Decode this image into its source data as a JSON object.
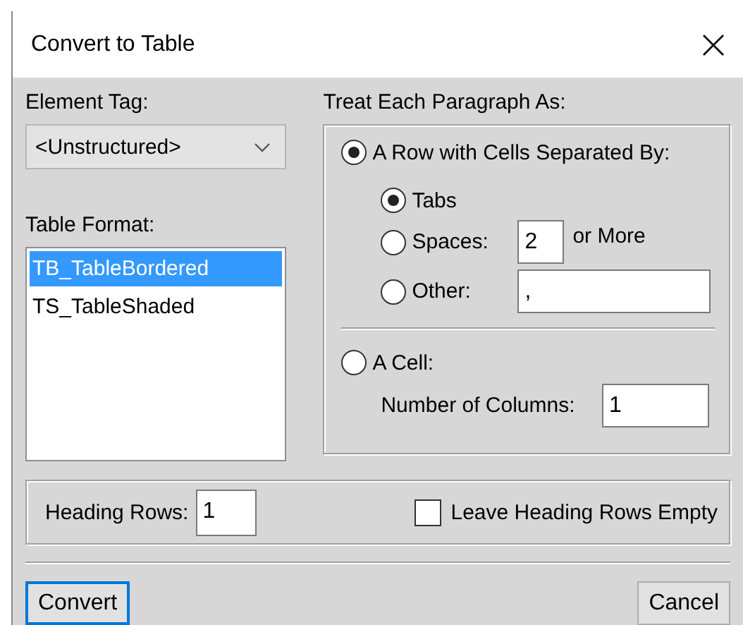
{
  "window": {
    "title": "Convert to Table"
  },
  "element_tag": {
    "label": "Element Tag:",
    "value": "<Unstructured>"
  },
  "table_format": {
    "label": "Table Format:",
    "items": [
      {
        "label": "TB_TableBordered",
        "selected": true
      },
      {
        "label": "TS_TableShaded",
        "selected": false
      }
    ]
  },
  "treat_as": {
    "label": "Treat Each Paragraph As:",
    "row": {
      "label": "A Row with Cells Separated By:",
      "selected": true,
      "separators": [
        {
          "kind": "plain",
          "label": "Tabs",
          "selected": true
        },
        {
          "kind": "count",
          "label": "Spaces:",
          "value": "2",
          "suffix": "or More",
          "selected": false
        },
        {
          "kind": "text",
          "label": "Other:",
          "value": ",",
          "selected": false
        }
      ]
    },
    "cell": {
      "label": "A Cell:",
      "selected": false,
      "columns_label": "Number of Columns:",
      "columns_value": "1"
    }
  },
  "heading": {
    "label": "Heading Rows:",
    "value": "1",
    "leave_empty": {
      "label": "Leave Heading Rows Empty",
      "checked": false
    }
  },
  "buttons": [
    {
      "label": "Convert",
      "default": true
    },
    {
      "label": "Cancel",
      "default": false
    }
  ]
}
